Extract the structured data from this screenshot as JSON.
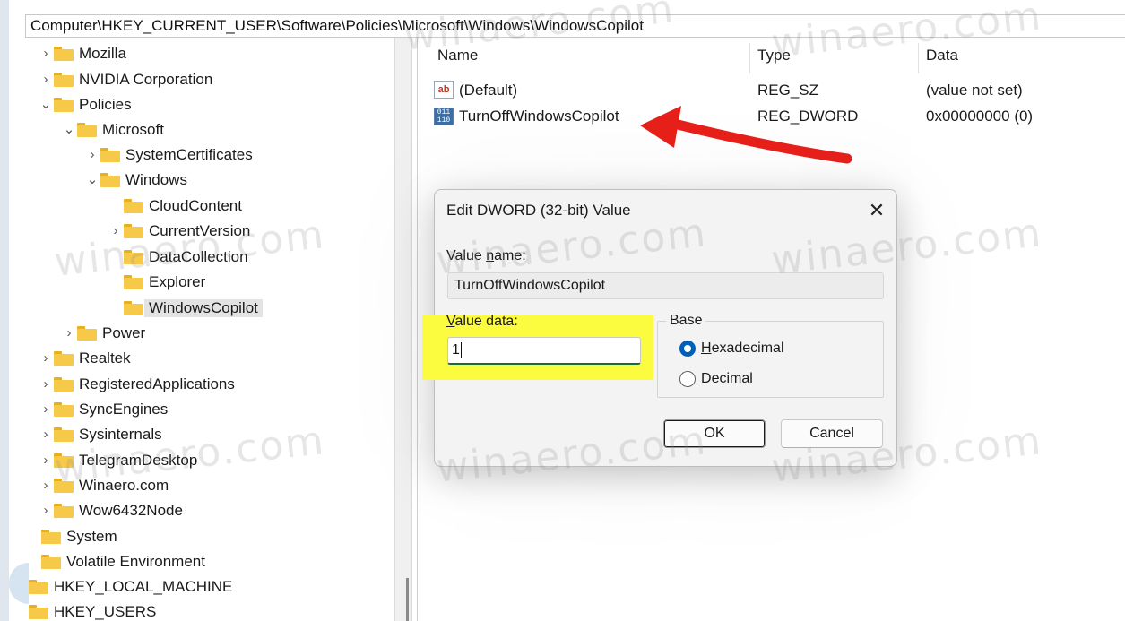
{
  "address": {
    "path": "Computer\\HKEY_CURRENT_USER\\Software\\Policies\\Microsoft\\Windows\\WindowsCopilot"
  },
  "tree": {
    "items": [
      {
        "label": "Mozilla",
        "chevron": "›"
      },
      {
        "label": "NVIDIA Corporation",
        "chevron": "›"
      },
      {
        "label": "Policies",
        "chevron": "⌄"
      },
      {
        "label": "Microsoft",
        "chevron": "⌄"
      },
      {
        "label": "SystemCertificates",
        "chevron": "›"
      },
      {
        "label": "Windows",
        "chevron": "⌄"
      },
      {
        "label": "CloudContent",
        "chevron": ""
      },
      {
        "label": "CurrentVersion",
        "chevron": "›"
      },
      {
        "label": "DataCollection",
        "chevron": ""
      },
      {
        "label": "Explorer",
        "chevron": ""
      },
      {
        "label": "WindowsCopilot",
        "chevron": ""
      },
      {
        "label": "Power",
        "chevron": "›"
      },
      {
        "label": "Realtek",
        "chevron": "›"
      },
      {
        "label": "RegisteredApplications",
        "chevron": "›"
      },
      {
        "label": "SyncEngines",
        "chevron": "›"
      },
      {
        "label": "Sysinternals",
        "chevron": "›"
      },
      {
        "label": "TelegramDesktop",
        "chevron": "›"
      },
      {
        "label": "Winaero.com",
        "chevron": "›"
      },
      {
        "label": "Wow6432Node",
        "chevron": "›"
      },
      {
        "label": "System",
        "chevron": ""
      },
      {
        "label": "Volatile Environment",
        "chevron": ""
      },
      {
        "label": "HKEY_LOCAL_MACHINE",
        "chevron": ""
      },
      {
        "label": "HKEY_USERS",
        "chevron": ""
      }
    ]
  },
  "list": {
    "headers": {
      "name": "Name",
      "type": "Type",
      "data": "Data"
    },
    "rows": [
      {
        "icon": "string-value-icon",
        "icon_text": "ab",
        "name": "(Default)",
        "type": "REG_SZ",
        "data": "(value not set)"
      },
      {
        "icon": "binary-value-icon",
        "icon_text": "011\n110",
        "name": "TurnOffWindowsCopilot",
        "type": "REG_DWORD",
        "data": "0x00000000 (0)"
      }
    ]
  },
  "dialog": {
    "title": "Edit DWORD (32-bit) Value",
    "close_icon": "close-icon",
    "value_name_label_pre": "Value ",
    "value_name_label_u": "n",
    "value_name_label_post": "ame:",
    "value_name": "TurnOffWindowsCopilot",
    "value_data_label_u": "V",
    "value_data_label_post": "alue data:",
    "value_data": "1",
    "base_label": "Base",
    "hex_u": "H",
    "hex_post": "exadecimal",
    "dec_u": "D",
    "dec_post": "ecimal",
    "selected_base": "Hexadecimal",
    "ok_label": "OK",
    "cancel_label": "Cancel"
  },
  "annotation": {
    "arrow_color": "#e8201a",
    "highlight_color": "#fbfb3f"
  },
  "watermark": {
    "text": "winaero.com"
  }
}
